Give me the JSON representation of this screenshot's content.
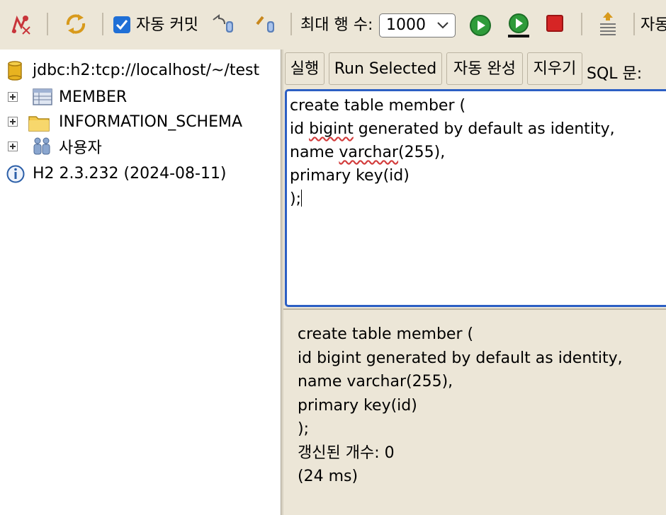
{
  "toolbar": {
    "icons": [
      "disconnect-icon",
      "refresh-icon",
      "rollback-icon",
      "commit-icon",
      "run-icon",
      "run-selected-icon",
      "stop-icon",
      "history-icon"
    ],
    "autocommit_checked": true,
    "autocommit_label": "자동 커밋",
    "max_rows_label": "최대 행 수:",
    "max_rows_value": "1000",
    "right_cut_label": "자동"
  },
  "tree": {
    "connection": "jdbc:h2:tcp://localhost/~/test",
    "items": [
      {
        "label": "MEMBER",
        "icon": "table-icon"
      },
      {
        "label": "INFORMATION_SCHEMA",
        "icon": "folder-icon"
      },
      {
        "label": "사용자",
        "icon": "users-icon"
      }
    ],
    "version": "H2 2.3.232 (2024-08-11)"
  },
  "buttons": {
    "run": "실행",
    "run_selected": "Run Selected",
    "auto_complete": "자동 완성",
    "clear": "지우기"
  },
  "sql_label": "SQL 문:",
  "editor": {
    "lines": [
      "create table member (",
      "id bigint generated by default as identity,",
      "name varchar(255),",
      "primary key(id)",
      ");"
    ]
  },
  "result": {
    "lines": [
      "create table member (",
      "id bigint generated by default as identity,",
      "name varchar(255),",
      "primary key(id)",
      ");",
      "갱신된 개수: 0",
      "(24 ms)"
    ]
  },
  "colors": {
    "toolbar_bg": "#ece6d7",
    "editor_border": "#2c5fc4",
    "run_green": "#2e9b3a",
    "stop_red": "#d62525"
  }
}
